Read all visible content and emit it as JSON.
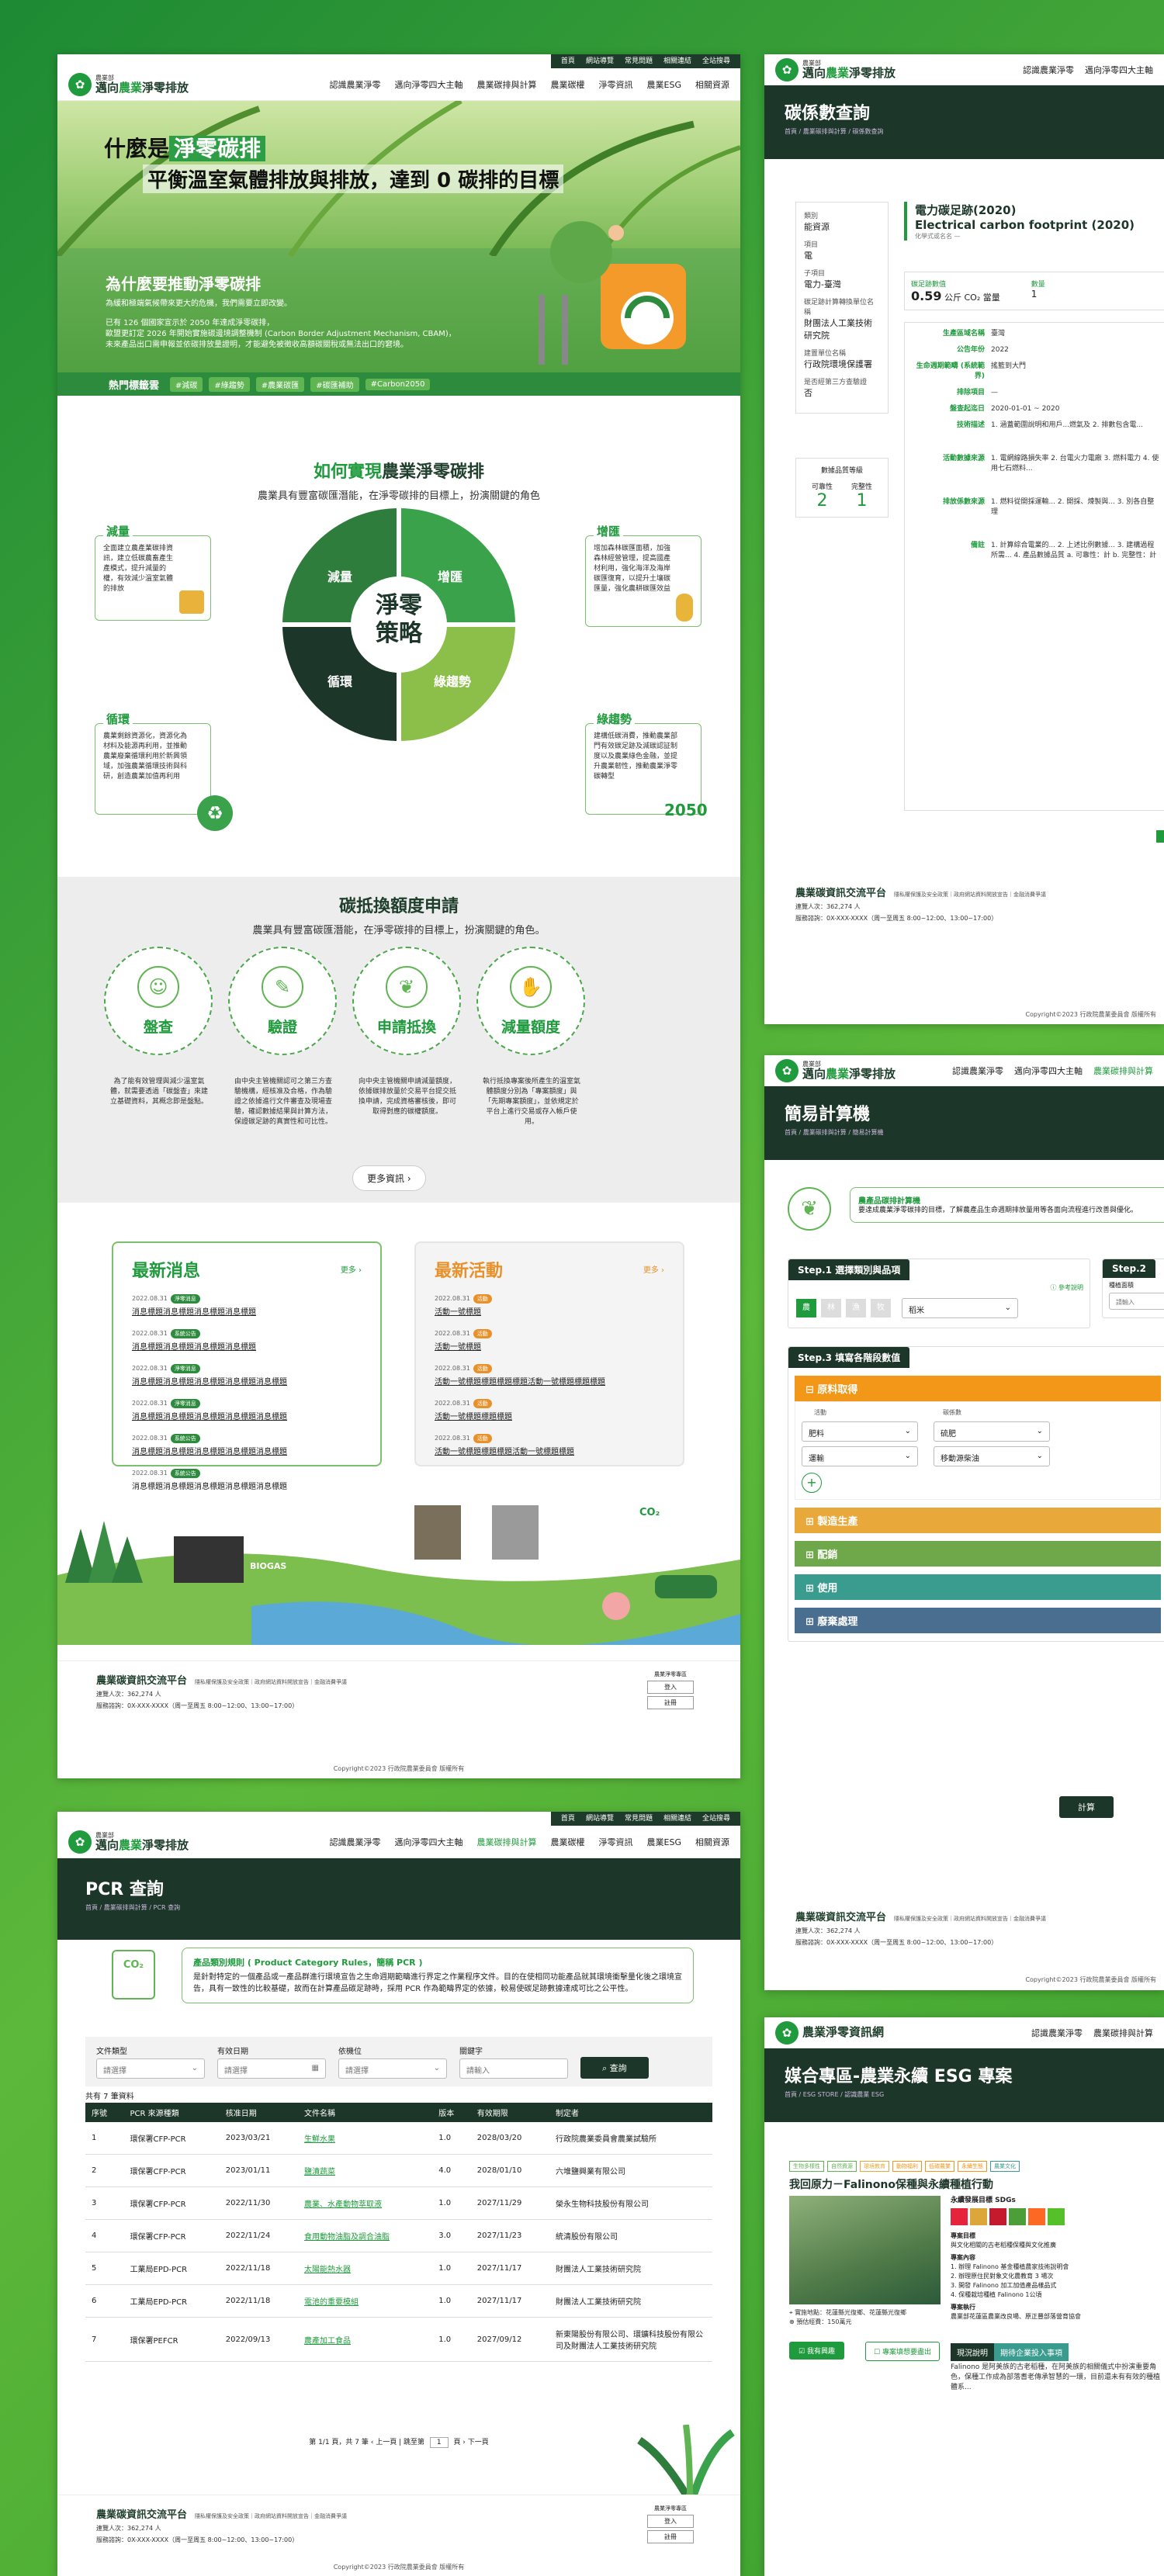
{
  "brand": {
    "sub": "農業部",
    "name_a": "邁向",
    "name_b": "農業",
    "name_c": "淨零排放",
    "short": "農業淨零資訊網"
  },
  "topnav": [
    "首頁",
    "網站導覽",
    "常見問題",
    "相關連結",
    "全站搜尋"
  ],
  "menu": [
    "認識農業淨零",
    "邁向淨零四大主軸",
    "農業碳排與計算",
    "農業碳權",
    "淨零資訊",
    "農業ESG",
    "相關資源"
  ],
  "home": {
    "hero_title_a": "什麼是",
    "hero_title_b": "淨零碳排",
    "hero_title_2": "平衡溫室氣體排放與排放，達到 0 碳排的目標",
    "why": "為什麼要推動淨零碳排",
    "why_p1": "為緩和極端氣候帶來更大的危機，我們需要立即改變。",
    "why_p2": "已有 126 個國家宣示於 2050 年達成淨零碳排，\n歐盟更訂定 2026 年開始實施碳邊境調整機制 (Carbon Border Adjustment Mechanism, CBAM)，\n未來產品出口需申報並依碳排放量證明，才能避免被徵收高額碳關稅或無法出口的窘境。",
    "hot_label": "熱門標籤雲",
    "hot_tags": [
      "#減碳",
      "#綠趨勢",
      "#農業碳匯",
      "#碳匯補助",
      "#Carbon2050"
    ],
    "how_title_a": "如何實現",
    "how_title_b": "農業淨零碳排",
    "how_sub": "農業具有豐富碳匯潛能，在淨零碳排的目標上，扮演關鍵的角色",
    "center": "淨零\n策略",
    "quad": [
      "減量",
      "增匯",
      "循環",
      "綠趨勢"
    ],
    "cards": {
      "reduce": {
        "t": "減量",
        "txt": "全面建立農產業碳排資訊，建立低碳農畜產生產模式，提升減量的權，有效減少溫室氣體的排放"
      },
      "sink": {
        "t": "增匯",
        "txt": "增加森林碳匯面積，加強森林經營管理，提高國產材利用，強化海洋及海岸碳匯復育，以提升土壤碳匯量，強化農耕碳匯效益"
      },
      "cycle": {
        "t": "循環",
        "txt": "農業剩餘資源化，資源化為材料及能源再利用，並推動農業廢棄循環利用於新興領域，加強農業循環技術與科研，創造農業加值再利用"
      },
      "green": {
        "t": "綠趨勢",
        "txt": "建構低碳消費，推動農業部門有效碳足跡及減碳認証制度以及農業綠色金融，並提升農業韌性，推動農業淨零碳轉型"
      }
    },
    "offset_title": "碳抵換額度申請",
    "offset_sub": "農業具有豐富碳匯潛能，在淨零碳排的目標上，扮演關鍵的角色。",
    "steps": [
      {
        "t": "盤查",
        "d": "為了能有效管理與減少溫室氣體，就需要透過「碳盤查」來建立基礎資料，其概念即是盤點。"
      },
      {
        "t": "驗證",
        "d": "由中央主管機關認可之第三方查驗機構，經核准及合格，作為驗證之依據進行文件審查及現場查驗，確認數據結果與計算方法，保證碳足跡的真實性和可比性。"
      },
      {
        "t": "申請抵換",
        "d": "向中央主管機關申請減量額度，依據碳排放量於交易平台提交抵換申請，完成資格審核後，即可取得對應的碳權額度。"
      },
      {
        "t": "減量額度",
        "d": "執行抵換專案後所產生的溫室氣體額度分別為「專案額度」與「先期專案額度」，並依規定於平台上進行交易或存入帳戶使用。"
      }
    ],
    "more": "更多資訊",
    "news": {
      "h": "最新消息",
      "more": "更多",
      "items": [
        {
          "d": "2022.08.31",
          "b": "淨零消息",
          "t": "消息標題消息標題消息標題消息標題"
        },
        {
          "d": "2022.08.31",
          "b": "系統公告",
          "t": "消息標題消息標題消息標題消息標題"
        },
        {
          "d": "2022.08.31",
          "b": "淨零消息",
          "t": "消息標題消息標題消息標題消息標題消息標題"
        },
        {
          "d": "2022.08.31",
          "b": "淨零消息",
          "t": "消息標題消息標題消息標題消息標題消息標題"
        },
        {
          "d": "2022.08.31",
          "b": "系統公告",
          "t": "消息標題消息標題消息標題消息標題消息標題"
        },
        {
          "d": "2022.08.31",
          "b": "系統公告",
          "t": "消息標題消息標題消息標題消息標題消息標題"
        }
      ]
    },
    "events": {
      "h": "最新活動",
      "more": "更多",
      "items": [
        {
          "d": "2022.08.31",
          "b": "活動",
          "t": "活動一號標題"
        },
        {
          "d": "2022.08.31",
          "b": "活動",
          "t": "活動一號標題"
        },
        {
          "d": "2022.08.31",
          "b": "活動",
          "t": "活動一號標題標題標題標題活動一號標題標題標題"
        },
        {
          "d": "2022.08.31",
          "b": "活動",
          "t": "活動一號標題標題標題"
        },
        {
          "d": "2022.08.31",
          "b": "活動",
          "t": "活動一號標題標題標題活動一號標題標題"
        }
      ]
    },
    "scene": {
      "biogas": "BIOGAS",
      "co2": "CO₂"
    }
  },
  "footer": {
    "title": "農業碳資訊交流平台",
    "slogan": "隱私權保護及安全政策｜政府網站資料開放宣告｜金融消費爭議",
    "addr": "連覽人次：362,274 人",
    "phone": "服務諮詢：0X-XXX-XXXX（周一至周五 8:00~12:00、13:00~17:00）",
    "login_h": "農業淨零專區",
    "login": "登入",
    "reg": "註冊",
    "copy": "Copyright©2023 行政院農業委員會 版權所有"
  },
  "carbon": {
    "title": "碳係數查詢",
    "bc": "首頁 / 農業碳排與計算 / 碳係數查詢",
    "fields": [
      {
        "l": "類別",
        "v": "能資源"
      },
      {
        "l": "項目",
        "v": "電"
      },
      {
        "l": "子項目",
        "v": "電力-臺灣"
      },
      {
        "l": "碳足跡計算轉換單位名稱",
        "v": "財團法人工業技術研究院"
      },
      {
        "l": "建置單位名稱",
        "v": "行政院環境保護署"
      },
      {
        "l": "是否經第三方查驗證",
        "v": "否"
      }
    ],
    "quality_h": "數據品質等級",
    "rel_l": "可靠性",
    "rel": "2",
    "comp_l": "完整性",
    "comp": "1",
    "head": "電力碳足跡(2020)",
    "head_en": "Electrical carbon footprint (2020)",
    "head_sub": "化學式或名名 —",
    "factor_l": "碳足跡數值",
    "factor": "0.59",
    "factor_u": "公斤 CO₂ 當量",
    "qty_l": "數量",
    "qty": "1",
    "rows": [
      {
        "l": "生產區域名稱",
        "v": "臺灣"
      },
      {
        "l": "公告年份",
        "v": "2022"
      },
      {
        "l": "生命週期範疇 (系統範界)",
        "v": "搖籃到大門"
      },
      {
        "l": "排除項目",
        "v": "—"
      },
      {
        "l": "盤查起迄日",
        "v": "2020-01-01 ~ 2020"
      },
      {
        "l": "技術描述",
        "v": "1. 涵蓋範圍說明和用戶...燃氣及 2. 排數包含電..."
      },
      {
        "l": "活動數據來源",
        "v": "1. 電網線路損失率 2. 台電火力電廠 3. 燃料電力 4. 使用七石燃料..."
      },
      {
        "l": "排放係數來源",
        "v": "1. 燃料從開採運輸... 2. 開採、煉製與... 3. 別各自整理"
      },
      {
        "l": "備註",
        "v": "1. 計算綜合電業的... 2. 上述比例數據... 3. 建構過程所需... 4. 產品數據品質 a. 可靠性：計 b. 完整性：計"
      }
    ]
  },
  "calc": {
    "title": "簡易計算機",
    "bc": "首頁 / 農業碳排與計算 / 簡易計算機",
    "intro_h": "農產品碳排計算機",
    "intro": "要達成農業淨零碳排的目標，了解農產品生命週期排放量用等各面向流程進行改善與優化。",
    "step1": "Step.1 選擇類別與品項",
    "step2": "Step.2",
    "ref": "參考說明",
    "cat_tabs": [
      "農",
      "林",
      "漁",
      "牧"
    ],
    "item": "稻米",
    "step2_l": "種植面積",
    "step2_ph": "請輸入",
    "step3": "Step.3 填寫各階段數值",
    "raw": "原料取得",
    "col_a": "活動",
    "col_b": "碳係數",
    "rows": [
      {
        "a": "肥料",
        "b": "硫肥"
      },
      {
        "a": "運輸",
        "b": "移動源柴油"
      }
    ],
    "stages": [
      "製造生產",
      "配銷",
      "使用",
      "廢棄處理"
    ],
    "calc_btn": "計算"
  },
  "pcr": {
    "title": "PCR 查詢",
    "bc": "首頁 / 農業碳排與計算 / PCR 查詢",
    "intro_h": "產品類別規則 ( Product Category Rules，簡稱 PCR )",
    "intro": "是針對特定的一個產品或一產品群進行環境宣告之生命週期範疇進行界定之作業程序文件。目的在使相同功能產品就其環境衝擊量化後之環境宣告，具有一致性的比較基礎，故而在計算產品碳足跡時，採用 PCR 作為範疇界定的依據，較易使碳足跡數據達成可比之公平性。",
    "f_type": "文件類型",
    "f_date": "有效日期",
    "f_org": "依機位",
    "f_kw": "關鍵字",
    "ph_sel": "請選擇",
    "ph_date": "請選擇",
    "ph_kw": "請輸入",
    "search": "查詢",
    "count": "共有 7 筆資料",
    "cols": [
      "序號",
      "PCR 來源種類",
      "核准日期",
      "文件名稱",
      "版本",
      "有效期限",
      "制定者"
    ],
    "rows": [
      [
        "1",
        "環保署CFP-PCR",
        "2023/03/21",
        "生鮮水果",
        "1.0",
        "2028/03/20",
        "行政院農業委員會農業試驗所"
      ],
      [
        "2",
        "環保署CFP-PCR",
        "2023/01/11",
        "鹽漬蔬菜",
        "4.0",
        "2028/01/10",
        "六堆鹽興業有限公司"
      ],
      [
        "3",
        "環保署CFP-PCR",
        "2022/11/30",
        "農業、水產動物萃取液",
        "1.0",
        "2027/11/29",
        "榮永生物科技股份有限公司"
      ],
      [
        "4",
        "環保署CFP-PCR",
        "2022/11/24",
        "食用動物油脂及調合油脂",
        "3.0",
        "2027/11/23",
        "統清股份有限公司"
      ],
      [
        "5",
        "工業局EPD-PCR",
        "2022/11/18",
        "太陽能熱水器",
        "1.0",
        "2027/11/17",
        "財團法人工業技術研究院"
      ],
      [
        "6",
        "工業局EPD-PCR",
        "2022/11/18",
        "電池的重要模組",
        "1.0",
        "2027/11/17",
        "財團法人工業技術研究院"
      ],
      [
        "7",
        "環保署PEFCR",
        "2022/09/13",
        "農產加工食品",
        "1.0",
        "2027/09/12",
        "新東陽股份有限公司、環鑛科技股份有限公司及財團法人工業技術研究院"
      ]
    ],
    "pager": "第 1/1 頁，共 7 筆 ‹ 上一頁 | 跳至第",
    "page": "1",
    "next": "頁 › 下一頁"
  },
  "esg": {
    "title": "媒合專區-農業永續 ESG 專案",
    "bc": "首頁 / ESG STORE / 認識農業 ESG",
    "filters": [
      "生物多樣性",
      "自然資源",
      "環境教育",
      "動物福利",
      "低碳農業",
      "永續生態",
      "農業文化"
    ],
    "proj": "我回原力－Falinono保種與永續種植行動",
    "sdg_h": "永續發展目標 SDGs",
    "loc": "實施地點：花蓮縣光復鄉、花蓮縣光復鄉",
    "cost": "預估經費：150萬元",
    "b1": "我有興趣",
    "b2": "專案填想要盡出",
    "desc_h": "專案目標",
    "desc": "與文化相關的古老稻種保種與文化推廣",
    "content_h": "專案內容",
    "content": [
      "1. 辦理 Falinono 基金種植農家技術說明會",
      "2. 辦理原住民對象文化農教育 3 場次",
      "3. 開發 Falinono 加工加值產品樣品式",
      "4. 保種栽培種植 Falinono 1公頃"
    ],
    "org_h": "專案執行",
    "org": "農業部花蓮區農業改良場、原正豐部落營育協會",
    "tab1": "現況說明",
    "tab2": "期待企業投入事項",
    "status": "Falinono 是阿美族的古老稻種，在阿美族的相關儀式中扮演重要角色，保種工作成為部落耆老傳承智慧的一環，目前還未有有效的種植體系..."
  },
  "colors": {
    "green": "#1f9a3c",
    "dark": "#1c3629",
    "orange": "#f29718",
    "yellow": "#e8a93a",
    "blue": "#4a7a96"
  }
}
